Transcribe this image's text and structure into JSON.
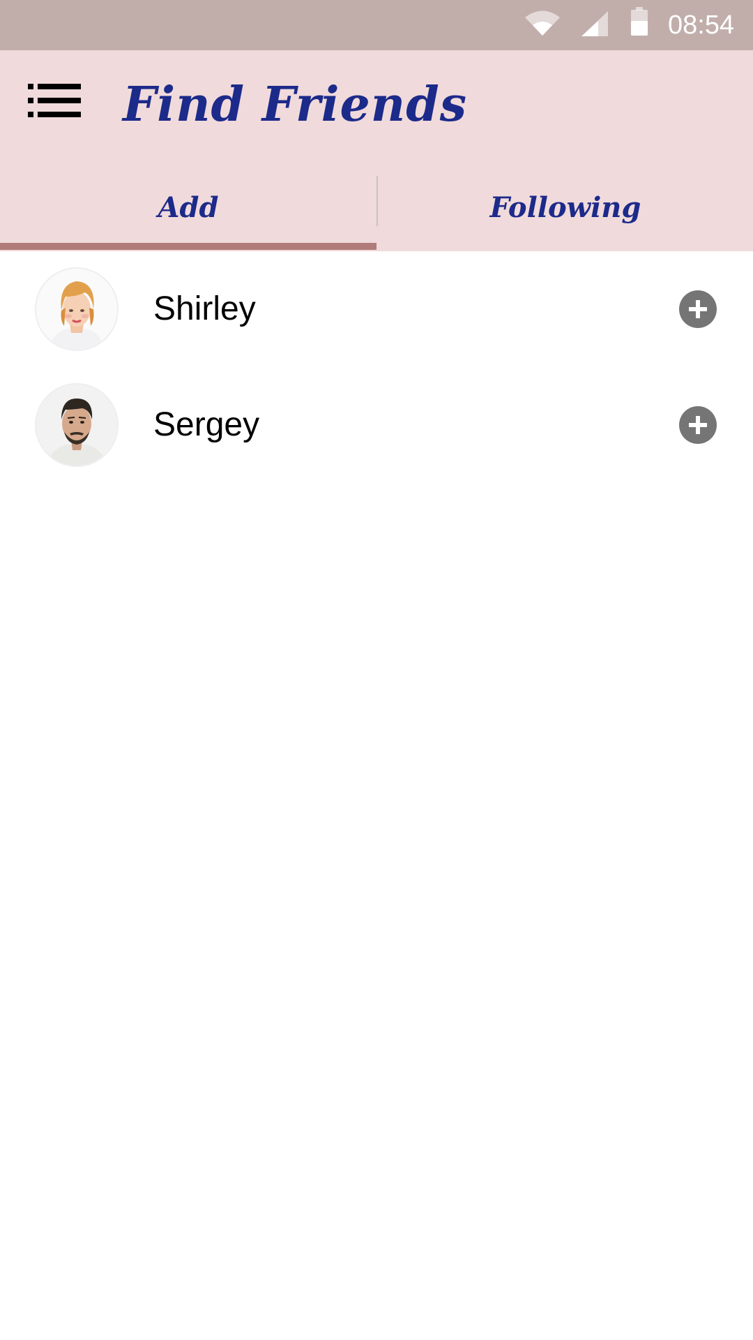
{
  "status_bar": {
    "time": "08:54",
    "icons": [
      "wifi-icon",
      "cell-signal-icon",
      "battery-icon"
    ]
  },
  "app_bar": {
    "title": "Find Friends",
    "menu_icon": "list-menu-icon"
  },
  "tabs": [
    {
      "label": "Add",
      "selected": true
    },
    {
      "label": "Following",
      "selected": false
    }
  ],
  "friends": [
    {
      "name": "Shirley",
      "action_icon": "add-circle-icon"
    },
    {
      "name": "Sergey",
      "action_icon": "add-circle-icon"
    }
  ],
  "colors": {
    "status_bar": "#c1aeab",
    "app_bar": "#f0dadb",
    "title_text": "#1c2a8a",
    "tab_indicator": "#b07b79",
    "add_button": "#757575"
  }
}
